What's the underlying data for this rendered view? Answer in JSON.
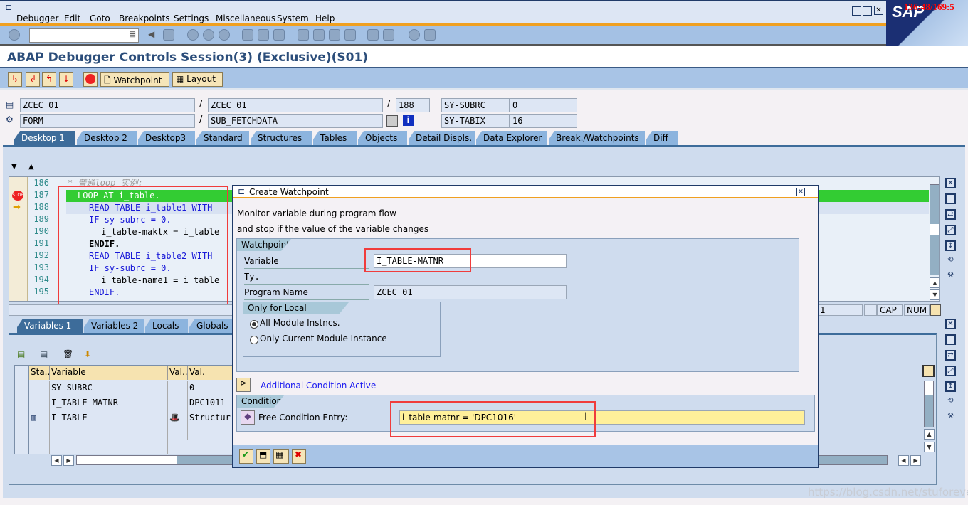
{
  "menu": [
    "Debugger",
    "Edit",
    "Goto",
    "Breakpoints",
    "Settings",
    "Miscellaneous",
    "System",
    "Help"
  ],
  "sap_logo": "SAP",
  "clock_overlay": "136:48/169:5",
  "title": "ABAP Debugger Controls Session(3)  (Exclusive)(S01)",
  "app_toolbar": {
    "watchpoint": "Watchpoint",
    "layout": "Layout"
  },
  "fields": {
    "program": "ZCEC_01",
    "include": "ZCEC_01",
    "line": "188",
    "event_type": "FORM",
    "event": "SUB_FETCHDATA",
    "sy_subrc_label": "SY-SUBRC",
    "sy_subrc": "0",
    "sy_tabix_label": "SY-TABIX",
    "sy_tabix": "16",
    "slash": "/"
  },
  "tabs": [
    "Desktop 1",
    "Desktop 2",
    "Desktop3",
    "Standard",
    "Structures",
    "Tables",
    "Objects",
    "Detail Displs.",
    "Data Explorer",
    "Break./Watchpoints",
    "Diff"
  ],
  "code": {
    "lines": [
      {
        "n": "186",
        "text": "* 普通loop 实例:"
      },
      {
        "n": "187",
        "text": "LOOP AT i_table."
      },
      {
        "n": "188",
        "text": "READ TABLE i_table1 WITH"
      },
      {
        "n": "189",
        "text": "IF sy-subrc = 0."
      },
      {
        "n": "190",
        "text": "i_table-maktx = i_table"
      },
      {
        "n": "191",
        "text": "ENDIF."
      },
      {
        "n": "192",
        "text": "READ TABLE i_table2 WITH"
      },
      {
        "n": "193",
        "text": "IF sy-subrc = 0."
      },
      {
        "n": "194",
        "text": "i_table-name1 = i_table"
      },
      {
        "n": "195",
        "text": "ENDIF."
      }
    ],
    "current_line_highlight": "#33cc33"
  },
  "status": {
    "pos": "1",
    "cap": "CAP",
    "num": "NUM"
  },
  "var_tabs": [
    "Variables 1",
    "Variables 2",
    "Locals",
    "Globals"
  ],
  "var_table": {
    "headers": [
      "Sta...",
      "Variable",
      "Val...",
      "Val."
    ],
    "rows": [
      {
        "variable": "SY-SUBRC",
        "value": "0"
      },
      {
        "variable": "I_TABLE-MATNR",
        "value": "DPC1011"
      },
      {
        "variable": "I_TABLE",
        "value": "Structur"
      }
    ]
  },
  "dialog": {
    "title": "Create Watchpoint",
    "desc1": "Monitor variable during program flow",
    "desc2": "and stop if the value of the variable changes",
    "group_watchpoint": "Watchpoint",
    "variable_label": "Variable",
    "variable_value": "I_TABLE-MATNR",
    "type_label": "Ty.",
    "program_label": "Program Name",
    "program_value": "ZCEC_01",
    "group_local": "Only for Local Variables",
    "radio_all": "All Module Instncs.",
    "radio_current": "Only Current Module Instance",
    "radio_selected": "all",
    "additional": "Additional Condition Active",
    "group_condition": "Condition",
    "condition_label": "Free Condition Entry:",
    "condition_value": "i_table-matnr = 'DPC1016'"
  },
  "watermark": "https://blog.csdn.net/stuforever"
}
